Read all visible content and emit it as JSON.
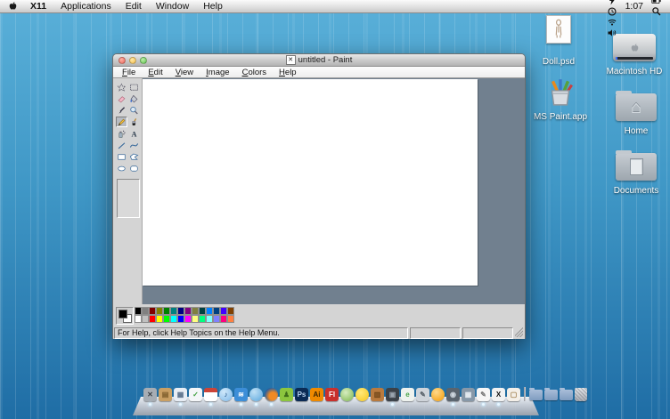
{
  "theme": {
    "desktop_top": "#5ab0d9",
    "desktop_bottom": "#1f6da5",
    "canvas_surround": "#71808f",
    "window_chrome": "#d4d4d4",
    "menubar_text": "#111111"
  },
  "menubar": {
    "apple_icon": "apple-icon",
    "items": [
      "X11",
      "Applications",
      "Edit",
      "Window",
      "Help"
    ],
    "status_icons": [
      "gray-ball",
      "evernote-elephant",
      "battery-bolt",
      "time-machine",
      "wifi",
      "volume"
    ],
    "clock": "1:07",
    "right_icons": [
      "battery",
      "spotlight"
    ]
  },
  "desktop_icons": [
    {
      "label": "Doll.psd",
      "type": "psd-file"
    },
    {
      "label": "Macintosh HD",
      "type": "drive"
    },
    {
      "label": "MS Paint.app",
      "type": "paint-app"
    },
    {
      "label": "Home",
      "type": "folder-home"
    },
    {
      "label": "Documents",
      "type": "folder-documents"
    }
  ],
  "paint_window": {
    "title": "untitled - Paint",
    "window_icon": "paint-document-icon",
    "window_controls": [
      "close",
      "minimize",
      "zoom"
    ],
    "menus": [
      "File",
      "Edit",
      "View",
      "Image",
      "Colors",
      "Help"
    ],
    "tools": [
      "free-form-select",
      "select",
      "eraser",
      "fill-with-color",
      "pick-color",
      "magnifier",
      "pencil",
      "brush",
      "airbrush",
      "text",
      "line",
      "curve",
      "rectangle",
      "polygon",
      "ellipse",
      "rounded-rectangle"
    ],
    "selected_tool": "pencil",
    "palette": {
      "foreground": "#000000",
      "background": "#FFFFFF",
      "row1": [
        "#000000",
        "#808080",
        "#800000",
        "#808000",
        "#008000",
        "#008080",
        "#000080",
        "#800080",
        "#808040",
        "#004040",
        "#0080FF",
        "#004080",
        "#4000FF",
        "#804000"
      ],
      "row2": [
        "#FFFFFF",
        "#C0C0C0",
        "#FF0000",
        "#FFFF00",
        "#00FF00",
        "#00FFFF",
        "#0000FF",
        "#FF00FF",
        "#FFFF80",
        "#00FF80",
        "#80FFFF",
        "#8080FF",
        "#FF0080",
        "#FF8040"
      ]
    },
    "status_message": "For Help, click Help Topics on the Help Menu."
  },
  "dock": {
    "items": [
      {
        "name": "grid-utility",
        "glyph": "✕",
        "bg": "#a7adb4",
        "fg": "#3c4248",
        "dot": true
      },
      {
        "name": "notebook",
        "glyph": "▤",
        "bg": "#c99f63",
        "fg": "#7a5a28",
        "dot": false
      },
      {
        "name": "preview",
        "glyph": "▦",
        "bg": "#e8edf4",
        "fg": "#5b708a",
        "dot": true
      },
      {
        "name": "checklist",
        "glyph": "✓",
        "bg": "#f4f6f8",
        "fg": "#3fa03f",
        "dot": false
      },
      {
        "name": "calendar",
        "glyph": "",
        "bg": "linear-gradient(#cc4438 0 32%, #ffffff 32%)",
        "fg": "#333333",
        "dot": true
      },
      {
        "name": "music",
        "glyph": "♪",
        "bg": "radial-gradient(circle at 35% 30%, #cfe8fa, #7db8e8)",
        "fg": "#1c4f86",
        "shape": "circle",
        "dot": false
      },
      {
        "name": "rss",
        "glyph": "≋",
        "bg": "#3c8ed8",
        "fg": "#ffffff",
        "dot": true
      },
      {
        "name": "blue-sphere",
        "glyph": "",
        "bg": "radial-gradient(circle at 35% 30%, #bfe0f5, #58a6dd)",
        "fg": "#ffffff",
        "shape": "circle",
        "dot": true
      },
      {
        "name": "firefox",
        "glyph": "",
        "bg": "radial-gradient(circle at 62% 62%, #f08a24 32%, #2a5d9e 72%)",
        "fg": "#ffffff",
        "shape": "circle",
        "dot": true
      },
      {
        "name": "green-figure",
        "glyph": "♟",
        "bg": "#8cc63e",
        "fg": "#3f6d1a",
        "dot": false
      },
      {
        "name": "photoshop",
        "glyph": "Ps",
        "bg": "#0b2b55",
        "fg": "#bcd6f2",
        "dot": false
      },
      {
        "name": "illustrator",
        "glyph": "Ai",
        "bg": "#ef8a00",
        "fg": "#3a2403",
        "dot": false
      },
      {
        "name": "flash",
        "glyph": "Fl",
        "bg": "#c9302c",
        "fg": "#ffffff",
        "dot": false
      },
      {
        "name": "leaf",
        "glyph": "",
        "bg": "radial-gradient(circle at 40% 35%, #d6edc0, #7bb54a)",
        "fg": "#2e5a14",
        "shape": "circle",
        "dot": false
      },
      {
        "name": "rubber-duck",
        "glyph": "",
        "bg": "radial-gradient(circle at 40% 35%, #ffe97a, #f5c518)",
        "fg": "#a06a00",
        "shape": "circle",
        "dot": false
      },
      {
        "name": "crate",
        "glyph": "▥",
        "bg": "#b97a3e",
        "fg": "#6e4418",
        "dot": false
      },
      {
        "name": "dark-photo",
        "glyph": "▣",
        "bg": "#3b4148",
        "fg": "#9aa4ae",
        "dot": true
      },
      {
        "name": "evernote",
        "glyph": "e",
        "bg": "#eef2ee",
        "fg": "#4aa54a",
        "dot": false
      },
      {
        "name": "silver-tool",
        "glyph": "✎",
        "bg": "#cfd4da",
        "fg": "#555e66",
        "dot": false
      },
      {
        "name": "orange-ball",
        "glyph": "",
        "bg": "radial-gradient(circle at 38% 32%, #ffd98c, #f59a00)",
        "fg": "#7a4d00",
        "shape": "circle",
        "dot": false
      },
      {
        "name": "camera",
        "glyph": "◉",
        "bg": "#5a646e",
        "fg": "#cdd6de",
        "dot": true
      },
      {
        "name": "pictures",
        "glyph": "▦",
        "bg": "#8798a8",
        "fg": "#e8eef4",
        "dot": false
      },
      {
        "name": "textedit",
        "glyph": "✎",
        "bg": "#f6f6f6",
        "fg": "#777777",
        "dot": true
      },
      {
        "name": "x11",
        "glyph": "X",
        "bg": "#f2f2f2",
        "fg": "#111111",
        "dot": true
      },
      {
        "name": "document",
        "glyph": "▢",
        "bg": "#f4efe8",
        "fg": "#a08050",
        "dot": false
      },
      {
        "name": "dock-separator",
        "type": "separator"
      },
      {
        "name": "stack-folder-1",
        "type": "folder"
      },
      {
        "name": "stack-folder-2",
        "type": "folder"
      },
      {
        "name": "stack-folder-3",
        "type": "folder"
      },
      {
        "name": "trash",
        "type": "trash"
      }
    ]
  }
}
